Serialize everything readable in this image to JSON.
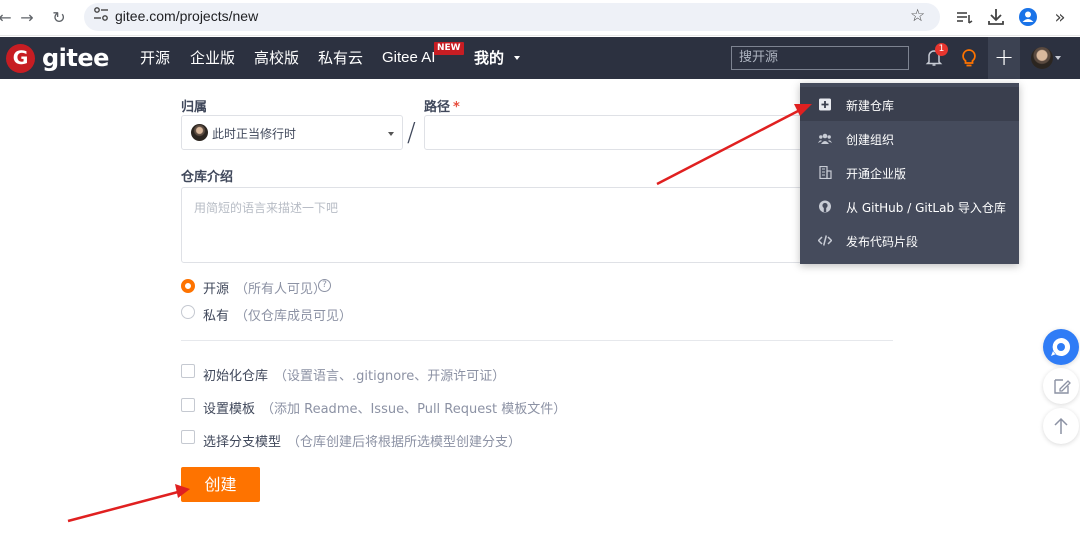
{
  "browser": {
    "url": "gitee.com/projects/new",
    "back": "←",
    "forward": "→",
    "reload": "↻",
    "more": "»"
  },
  "header": {
    "logo_letter": "G",
    "logo_text": "gitee",
    "nav": [
      "开源",
      "企业版",
      "高校版",
      "私有云",
      "Gitee AI",
      "我的"
    ],
    "new_badge": "NEW",
    "search_placeholder": "搜开源",
    "notification_count": "1",
    "plus": "+"
  },
  "dropdown": {
    "items": [
      {
        "label": "新建仓库",
        "icon": "square-plus-icon"
      },
      {
        "label": "创建组织",
        "icon": "group-icon"
      },
      {
        "label": "开通企业版",
        "icon": "building-icon"
      },
      {
        "label": "从 GitHub / GitLab 导入仓库",
        "icon": "github-icon"
      },
      {
        "label": "发布代码片段",
        "icon": "code-icon"
      }
    ]
  },
  "form": {
    "owner_label": "归属",
    "owner_value": "此时正当修行时",
    "path_label": "路径",
    "required_mark": "*",
    "separator": "/",
    "desc_label": "仓库介绍",
    "desc_placeholder": "用简短的语言来描述一下吧",
    "visibility": [
      {
        "label": "开源",
        "hint": "（所有人可见）",
        "selected": true
      },
      {
        "label": "私有",
        "hint": "（仅仓库成员可见）",
        "selected": false
      }
    ],
    "help_icon": "?",
    "options": [
      {
        "label": "初始化仓库",
        "hint": "（设置语言、.gitignore、开源许可证）"
      },
      {
        "label": "设置模板",
        "hint": "（添加 Readme、Issue、Pull Request 模板文件）"
      },
      {
        "label": "选择分支模型",
        "hint": "（仓库创建后将根据所选模型创建分支）"
      }
    ],
    "create_label": "创建"
  },
  "colors": {
    "header_bg": "#2c3140",
    "accent": "#fe7300",
    "brand_red": "#c71d23",
    "menu_bg": "#454b5c",
    "annotation_arrow": "#e02020"
  }
}
